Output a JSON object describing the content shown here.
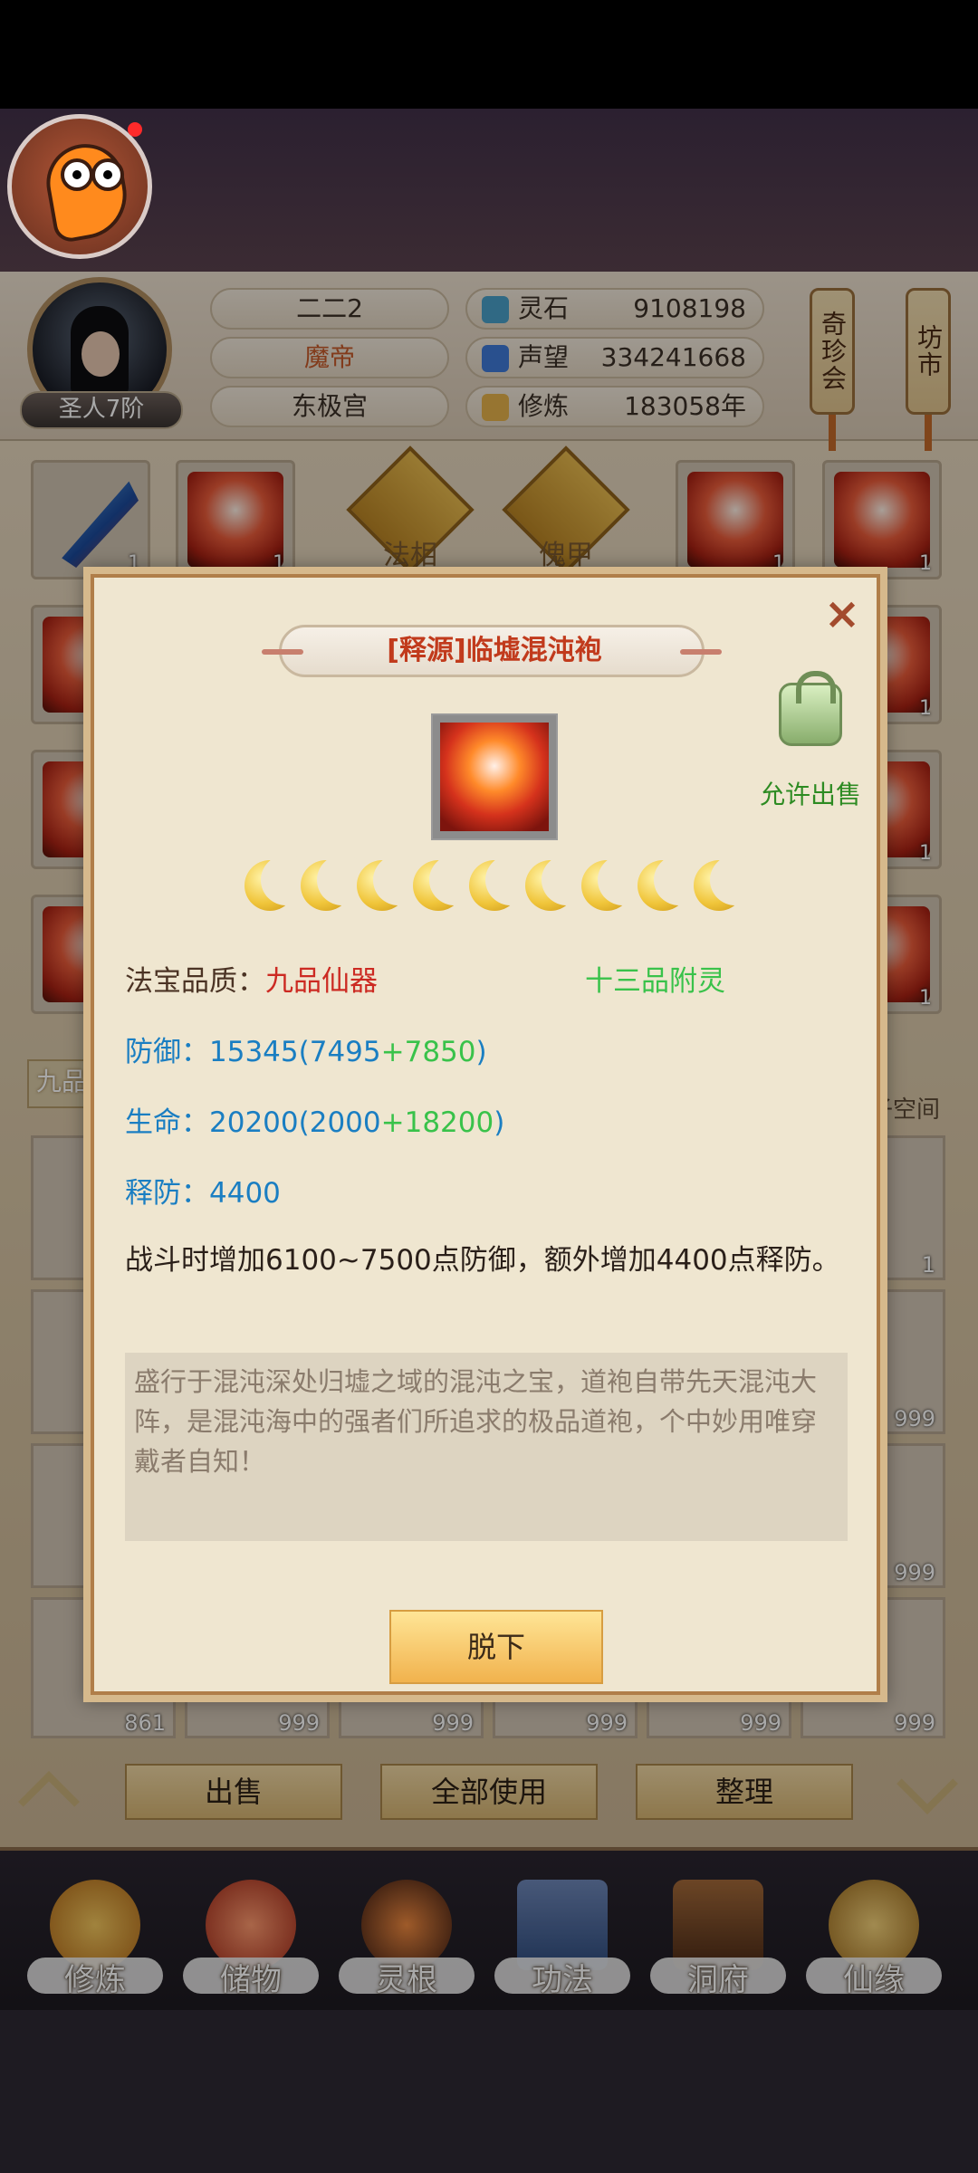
{
  "header": {
    "player": {
      "rank": "圣人7阶",
      "name": "二二2",
      "title": "魔帝",
      "sect": "东极宫"
    },
    "resources": [
      {
        "icon": "spirit-stone-icon",
        "label": "灵石",
        "value": "9108198"
      },
      {
        "icon": "prestige-icon",
        "label": "声望",
        "value": "334241668"
      },
      {
        "icon": "cultivation-icon",
        "label": "修炼",
        "value": "183058年"
      }
    ],
    "buttons": [
      {
        "label": "奇珍会"
      },
      {
        "label": "坊市"
      }
    ]
  },
  "inventory": {
    "slots": [
      {
        "slot": "法相"
      },
      {
        "slot": "傀甲"
      }
    ],
    "tab_label": "九品",
    "side_label": "子空间",
    "counts": [
      "1",
      "1",
      "1",
      "1",
      "1",
      "1",
      "1",
      "1",
      "1",
      "1",
      "1"
    ],
    "lower_counts": [
      "861",
      "999",
      "999",
      "999",
      "999",
      "999",
      "1",
      "999",
      "999"
    ]
  },
  "actions": {
    "sell": "出售",
    "use_all": "全部使用",
    "organize": "整理"
  },
  "bottom_nav": [
    {
      "label": "修炼"
    },
    {
      "label": "储物"
    },
    {
      "label": "灵根"
    },
    {
      "label": "功法"
    },
    {
      "label": "洞府"
    },
    {
      "label": "仙缘"
    }
  ],
  "modal": {
    "title": "[释源]临墟混沌袍",
    "sell_status": "允许出售",
    "stars": 9,
    "quality_label": "法宝品质：",
    "quality_value": "九品仙器",
    "extra_grade": "十三品附灵",
    "defense": {
      "label": "防御：",
      "total": "15345",
      "base": "7495",
      "bonus": "+7850"
    },
    "hp": {
      "label": "生命：",
      "total": "20200",
      "base": "2000",
      "bonus": "+18200"
    },
    "resist": {
      "label": "释防：",
      "total": "4400"
    },
    "effect": "战斗时增加6100~7500点防御，额外增加4400点释防。",
    "description": "盛行于混沌深处归墟之域的混沌之宝，道袍自带先天混沌大阵，是混沌海中的强者们所追求的极品道袍，个中妙用唯穿戴者自知！",
    "button": "脱下"
  },
  "colors": {
    "quality_red": "#cc2a22",
    "stat_blue": "#1a7ec2",
    "bonus_green": "#39c24a",
    "title_red": "#c13a1c"
  }
}
